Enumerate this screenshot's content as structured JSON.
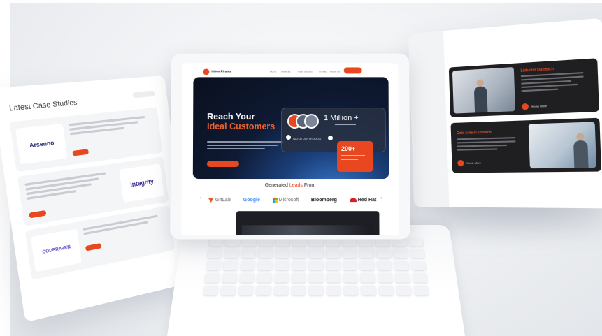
{
  "left_panel": {
    "title": "Latest Case Studies",
    "cards": [
      {
        "brand": "Arsenno"
      },
      {
        "brand": "integrity"
      },
      {
        "brand": "CODERAVEN"
      }
    ]
  },
  "laptop": {
    "nav": {
      "logo": "Inbox Pirates",
      "links": [
        "Home",
        "Services",
        "Case Studies",
        "Contact",
        "About Us"
      ]
    },
    "hero": {
      "title_line1": "Reach Your",
      "title_line2": "Ideal Customers",
      "stat_number": "1 Million +",
      "watch_label": "WATCH OUR PROCESS",
      "badge_number": "200+"
    },
    "generated": {
      "prefix": "Generated",
      "accent": "Leads",
      "suffix": "From",
      "brands": [
        "GitLab",
        "Google",
        "Microsoft",
        "Bloomberg",
        "Red Hat"
      ]
    }
  },
  "right_panel": {
    "services": [
      {
        "title": "LinkedIn Outreach",
        "link": "Know More"
      },
      {
        "title": "Cold Email Outreach",
        "link": "Know More"
      }
    ]
  },
  "colors": {
    "accent": "#e8471f",
    "hero_dark": "#0e1a33",
    "service_card": "#1f1f22"
  }
}
